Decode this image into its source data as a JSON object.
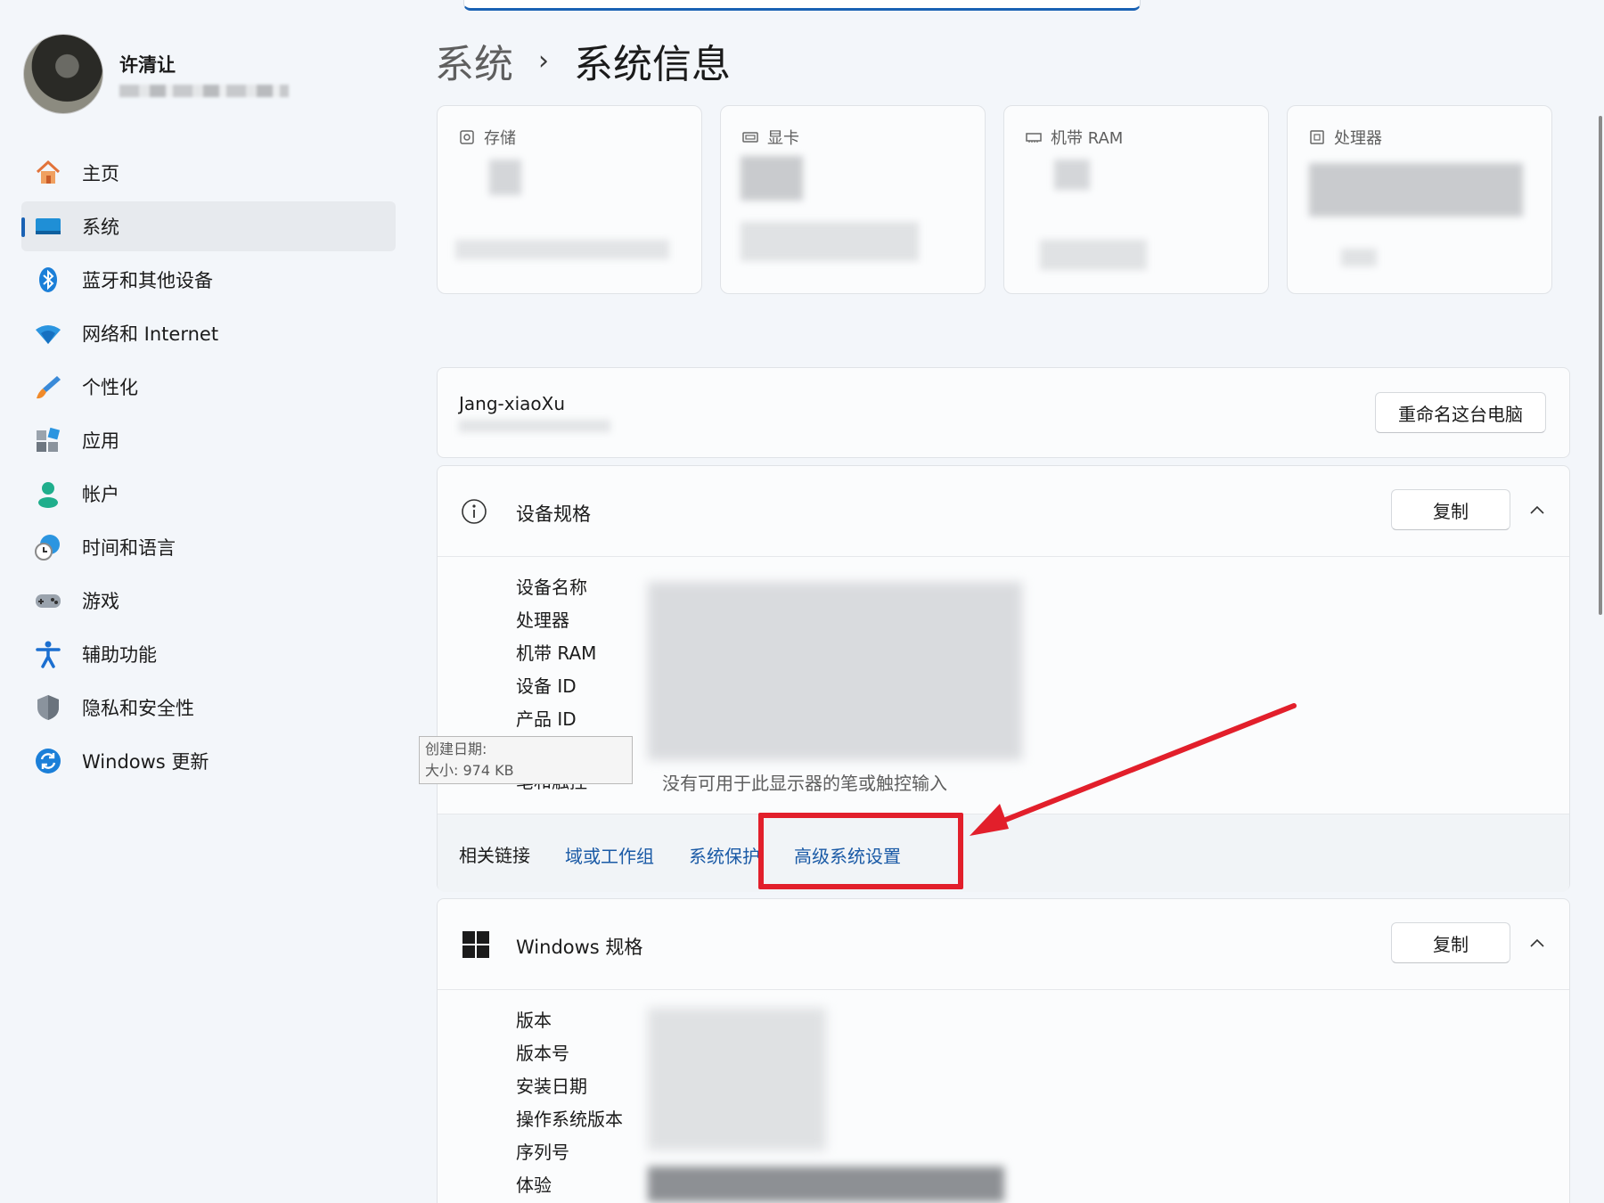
{
  "user": {
    "name": "许清让"
  },
  "breadcrumb": {
    "parent": "系统",
    "separator": "›",
    "current": "系统信息"
  },
  "sidebar": {
    "items": [
      {
        "label": "主页",
        "icon": "home-icon",
        "active": false
      },
      {
        "label": "系统",
        "icon": "system-icon",
        "active": true
      },
      {
        "label": "蓝牙和其他设备",
        "icon": "bluetooth-icon",
        "active": false
      },
      {
        "label": "网络和 Internet",
        "icon": "wifi-icon",
        "active": false
      },
      {
        "label": "个性化",
        "icon": "brush-icon",
        "active": false
      },
      {
        "label": "应用",
        "icon": "apps-icon",
        "active": false
      },
      {
        "label": "帐户",
        "icon": "account-icon",
        "active": false
      },
      {
        "label": "时间和语言",
        "icon": "time-language-icon",
        "active": false
      },
      {
        "label": "游戏",
        "icon": "gamepad-icon",
        "active": false
      },
      {
        "label": "辅助功能",
        "icon": "accessibility-icon",
        "active": false
      },
      {
        "label": "隐私和安全性",
        "icon": "shield-icon",
        "active": false
      },
      {
        "label": "Windows 更新",
        "icon": "update-icon",
        "active": false
      }
    ]
  },
  "cards": [
    {
      "title": "存储",
      "icon": "storage-icon"
    },
    {
      "title": "显卡",
      "icon": "gpu-icon"
    },
    {
      "title": "机带 RAM",
      "icon": "ram-icon"
    },
    {
      "title": "处理器",
      "icon": "cpu-icon"
    }
  ],
  "computer": {
    "name": "Jang-xiaoXu",
    "rename_label": "重命名这台电脑"
  },
  "device_specs": {
    "title": "设备规格",
    "copy_label": "复制",
    "rows": [
      "设备名称",
      "处理器",
      "机带 RAM",
      "设备 ID",
      "产品 ID"
    ],
    "pen_label": "笔和触控",
    "pen_value": "没有可用于此显示器的笔或触控输入"
  },
  "tooltip": {
    "line1": "创建日期:",
    "line2": "大小: 974 KB"
  },
  "related_links": {
    "label": "相关链接",
    "links": [
      "域或工作组",
      "系统保护",
      "高级系统设置"
    ]
  },
  "windows_specs": {
    "title": "Windows 规格",
    "copy_label": "复制",
    "rows": [
      "版本",
      "版本号",
      "安装日期",
      "操作系统版本",
      "序列号",
      "体验"
    ]
  },
  "colors": {
    "accent": "#1a62b4",
    "link": "#1a5aa6",
    "annotation": "#e21f2b"
  }
}
